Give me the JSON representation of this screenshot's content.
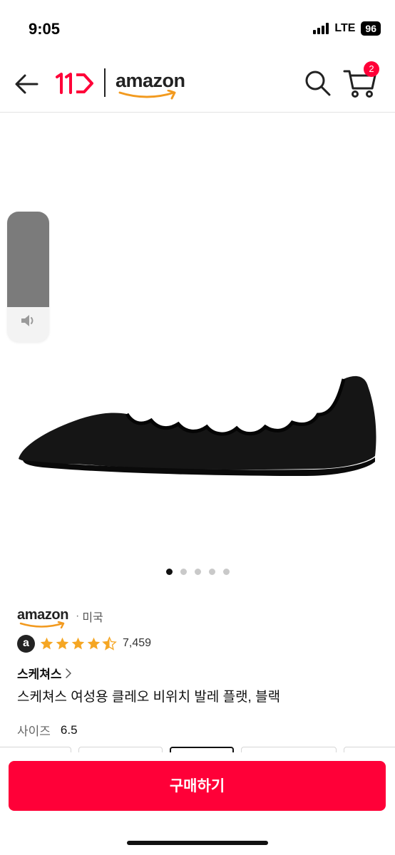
{
  "status_bar": {
    "time": "9:05",
    "network": "LTE",
    "battery": "96"
  },
  "header": {
    "back_icon": "arrow-left-icon",
    "logo_11st": "11st-logo",
    "logo_amazon": "amazon",
    "search_icon": "search-icon",
    "cart_icon": "cart-icon",
    "cart_count": "2"
  },
  "gallery": {
    "image": "black scalloped knit ballet flat",
    "page_count": 5,
    "active_index": 0,
    "volume_level": 0.73
  },
  "product": {
    "seller_logo": "amazon",
    "seller_sep": "·",
    "seller_country": "미국",
    "rating_badge": "a",
    "rating_stars": 4.5,
    "review_count": "7,459",
    "brand": "스케쳐스",
    "title": "스케쳐스 여성용 클레오 비위치 발레 플랫, 블랙",
    "size_label": "사이즈",
    "size_value": "6.5"
  },
  "buy": {
    "label": "구매하기"
  },
  "colors": {
    "accent": "#ff0038",
    "star": "#f5a623",
    "text": "#111111"
  }
}
